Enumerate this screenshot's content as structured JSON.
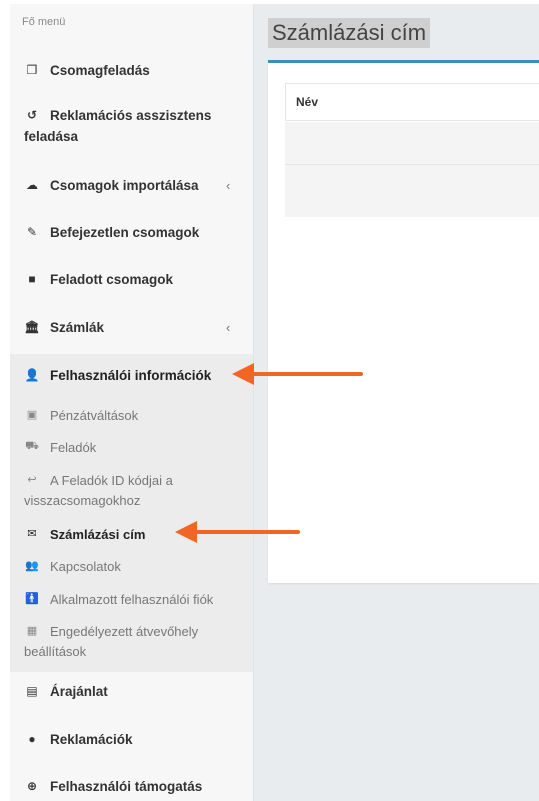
{
  "sidebar": {
    "header": "Fő menü",
    "items": [
      {
        "label": "Csomagfeladás",
        "icon": "cube-icon"
      },
      {
        "label": "Reklamációs asszisztens",
        "label2": "feladása",
        "icon": "undo-icon"
      },
      {
        "label": "Csomagok importálása",
        "icon": "cloud-upload-icon",
        "caret": "‹"
      },
      {
        "label": "Befejezetlen csomagok",
        "icon": "edit-icon"
      },
      {
        "label": "Feladott csomagok",
        "icon": "archive-icon"
      },
      {
        "label": "Számlák",
        "icon": "bank-icon",
        "caret": "‹"
      },
      {
        "label": "Felhasználói információk",
        "icon": "user-icon"
      }
    ],
    "submenu": [
      {
        "label": "Pénzátváltások",
        "icon": "money-icon"
      },
      {
        "label": "Feladók",
        "icon": "cart-icon"
      },
      {
        "label": "A Feladók ID kódjai a",
        "label2": "visszacsomagokhoz",
        "icon": "reply-icon"
      },
      {
        "label": "Számlázási cím",
        "icon": "envelope-icon",
        "active": true
      },
      {
        "label": "Kapcsolatok",
        "icon": "users-icon"
      },
      {
        "label": "Alkalmazott felhasználói fiók",
        "icon": "person-icon"
      },
      {
        "label": "Engedélyezett átvevőhely",
        "label2": "beállítások",
        "icon": "grid-icon"
      }
    ],
    "bottom_items": [
      {
        "label": "Árajánlat",
        "icon": "list-card-icon"
      },
      {
        "label": "Reklamációk",
        "icon": "exclamation-circle-icon"
      },
      {
        "label": "Felhasználói támogatás",
        "icon": "life-ring-icon"
      }
    ]
  },
  "main": {
    "title": "Számlázási cím",
    "table": {
      "columns": [
        "Név"
      ]
    }
  },
  "colors": {
    "accent": "#3c8dbc",
    "arrow": "#f26522"
  }
}
